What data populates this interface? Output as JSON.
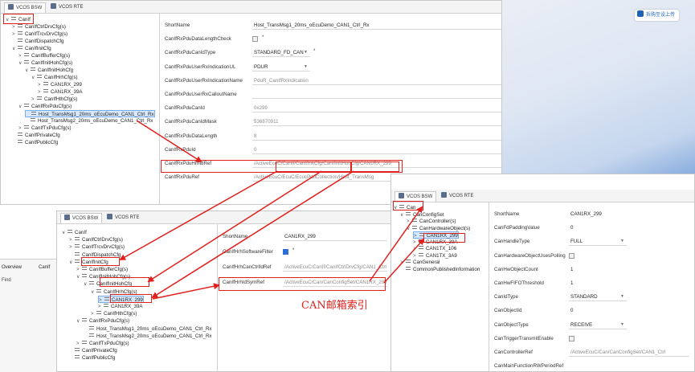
{
  "colors": {
    "annotation": "#e0201c",
    "selection": "#d6e8fb",
    "checkbox_on": "#2a6fd6",
    "desktop": "#1d63b8"
  },
  "ext_button": {
    "label": "拆购至设上传"
  },
  "panel1": {
    "tabs": [
      "VCOS BSW",
      "VCOS RTE"
    ],
    "tree": [
      {
        "label": "CanIf",
        "level": 0,
        "chev": "∨"
      },
      {
        "label": "CanIfCtrlDrvCfg(s)",
        "level": 1,
        "chev": ">"
      },
      {
        "label": "CanIfTrcvDrvCfg(s)",
        "level": 1,
        "chev": ">"
      },
      {
        "label": "CanIfDispatchCfg",
        "level": 1,
        "chev": ""
      },
      {
        "label": "CanIfInitCfg",
        "level": 1,
        "chev": "∨"
      },
      {
        "label": "CanIfBufferCfg(s)",
        "level": 2,
        "chev": ">"
      },
      {
        "label": "CanIfInitHohCfg(s)",
        "level": 2,
        "chev": "∨"
      },
      {
        "label": "CanIfInitHohCfg",
        "level": 3,
        "chev": "∨"
      },
      {
        "label": "CanIfHrhCfg(s)",
        "level": 4,
        "chev": "∨"
      },
      {
        "label": "CAN1RX_299",
        "level": 5,
        "chev": ">"
      },
      {
        "label": "CAN1RX_39A",
        "level": 5,
        "chev": ">"
      },
      {
        "label": "CanIfHthCfg(s)",
        "level": 4,
        "chev": ">"
      },
      {
        "label": "CanIfRxPduCfg(s)",
        "level": 2,
        "chev": "∨"
      },
      {
        "label": "Host_TransMsg1_20ms_oEcuDemo_CAN1_Ctrl_Rx",
        "level": 3,
        "chev": ""
      },
      {
        "label": "Host_TransMsg2_20ms_oEcuDemo_CAN1_Ctrl_Rx",
        "level": 3,
        "chev": ""
      },
      {
        "label": "CanIfTxPduCfg(s)",
        "level": 2,
        "chev": ">"
      },
      {
        "label": "CanIfPrivateCfg",
        "level": 1,
        "chev": ""
      },
      {
        "label": "CanIfPublicCfg",
        "level": 1,
        "chev": ""
      }
    ],
    "props": [
      {
        "label": "ShortName",
        "value": "Host_TransMsg1_20ms_oEcuDemo_CAN1_Ctrl_Rx",
        "style": "box"
      },
      {
        "label": "CanIfRxPduDataLengthCheck",
        "value": "",
        "style": "check",
        "star": "*"
      },
      {
        "label": "CanIfRxPduCanIdType",
        "value": "STANDARD_FD_CAN",
        "style": "drop",
        "star": "*"
      },
      {
        "label": "CanIfRxPduUserRxIndicationUL",
        "value": "PDUR",
        "style": "drop"
      },
      {
        "label": "CanIfRxPduUserRxIndicationName",
        "value": "PduR_CanIfRxIndication",
        "style": "grey"
      },
      {
        "label": "CanIfRxPduUserRxCalloutName",
        "value": "",
        "style": "grey"
      },
      {
        "label": "CanIfRxPduCanId",
        "value": "0x299",
        "style": "grey"
      },
      {
        "label": "CanIfRxPduCanIdMask",
        "value": "536870911",
        "style": "grey"
      },
      {
        "label": "CanIfRxPduDataLength",
        "value": "8",
        "style": "grey"
      },
      {
        "label": "CanIfRxPduId",
        "value": "0",
        "style": "grey"
      },
      {
        "label": "CanIfRxPduHrhIdRef",
        "value": "/ActiveEcuC/CanIf/CanIfInitCfg/CanIfInitHohCfg/CAN1RX_299",
        "style": "grey"
      },
      {
        "label": "CanIfRxPduRef",
        "value": "/ActiveEcuC/EcuC/EcucPduCollection/Host_TransMsg",
        "style": "grey"
      }
    ]
  },
  "panel2": {
    "tabs": [
      "VCOS BSW",
      "VCOS RTE"
    ],
    "tree": [
      {
        "label": "CanIf",
        "level": 0,
        "chev": "∨"
      },
      {
        "label": "CanIfCtrlDrvCfg(s)",
        "level": 1,
        "chev": ">"
      },
      {
        "label": "CanIfTrcvDrvCfg(s)",
        "level": 1,
        "chev": ">"
      },
      {
        "label": "CanIfDispatchCfg",
        "level": 1,
        "chev": ""
      },
      {
        "label": "CanIfInitCfg",
        "level": 1,
        "chev": "∨"
      },
      {
        "label": "CanIfBufferCfg(s)",
        "level": 2,
        "chev": ">"
      },
      {
        "label": "CanIfInitHohCfg(s)",
        "level": 2,
        "chev": "∨"
      },
      {
        "label": "CanIfInitHohCfg",
        "level": 3,
        "chev": "∨"
      },
      {
        "label": "CanIfHrhCfg(s)",
        "level": 4,
        "chev": "∨"
      },
      {
        "label": "CAN1RX_299",
        "level": 5,
        "chev": ">"
      },
      {
        "label": "CAN1RX_39A",
        "level": 5,
        "chev": ">"
      },
      {
        "label": "CanIfHthCfg(s)",
        "level": 4,
        "chev": ">"
      },
      {
        "label": "CanIfRxPduCfg(s)",
        "level": 2,
        "chev": "∨"
      },
      {
        "label": "Host_TransMsg1_20ms_oEcuDemo_CAN1_Ctrl_Rx",
        "level": 3,
        "chev": ""
      },
      {
        "label": "Host_TransMsg2_20ms_oEcuDemo_CAN1_Ctrl_Rx",
        "level": 3,
        "chev": ""
      },
      {
        "label": "CanIfTxPduCfg(s)",
        "level": 2,
        "chev": ">"
      },
      {
        "label": "CanIfPrivateCfg",
        "level": 1,
        "chev": ""
      },
      {
        "label": "CanIfPublicCfg",
        "level": 1,
        "chev": ""
      }
    ],
    "props": [
      {
        "label": "ShortName",
        "value": "CAN1RX_299",
        "style": "box"
      },
      {
        "label": "CanIfHrhSoftwareFilter",
        "value": "",
        "style": "checkon",
        "star": "*"
      },
      {
        "label": "CanIfHrhCanCtrlIdRef",
        "value": "/ActiveEcuC/CanIf/CanIfCtrlDrvCfg/CAN1_Ctrl",
        "style": "grey"
      },
      {
        "label": "CanIfHrhIdSymRef",
        "value": "/ActiveEcuC/Can/CanConfigSet/CAN1RX_299",
        "style": "grey"
      }
    ]
  },
  "panel3": {
    "tabs": [
      "VCOS BSW",
      "VCOS RTE"
    ],
    "tree": [
      {
        "label": "Can",
        "level": 0,
        "chev": "∨"
      },
      {
        "label": "CanConfigSet",
        "level": 1,
        "chev": "∨"
      },
      {
        "label": "CanController(s)",
        "level": 2,
        "chev": ">"
      },
      {
        "label": "CanHardwareObject(s)",
        "level": 2,
        "chev": "∨"
      },
      {
        "label": "CAN1RX_299",
        "level": 3,
        "chev": ">"
      },
      {
        "label": "CAN1RX_39A",
        "level": 3,
        "chev": ">"
      },
      {
        "label": "CAN1TX_106",
        "level": 3,
        "chev": ">"
      },
      {
        "label": "CAN1TX_3A9",
        "level": 3,
        "chev": ">"
      },
      {
        "label": "CanGeneral",
        "level": 1,
        "chev": ">"
      },
      {
        "label": "CommonPublishedInformation",
        "level": 1,
        "chev": ""
      }
    ],
    "props": [
      {
        "label": "ShortName",
        "value": "CAN1RX_299",
        "style": "plain"
      },
      {
        "label": "CanFdPaddingValue",
        "value": "0",
        "style": "plain"
      },
      {
        "label": "CanHandleType",
        "value": "FULL",
        "style": "drop"
      },
      {
        "label": "CanHardwareObjectUsesPolling",
        "value": "",
        "style": "check"
      },
      {
        "label": "CanHwObjectCount",
        "value": "1",
        "style": "plain"
      },
      {
        "label": "CanHwFIFOThreshold",
        "value": "1",
        "style": "plain"
      },
      {
        "label": "CanIdType",
        "value": "STANDARD",
        "style": "drop"
      },
      {
        "label": "CanObjectId",
        "value": "0",
        "style": "plain"
      },
      {
        "label": "CanObjectType",
        "value": "RECEIVE",
        "style": "drop"
      },
      {
        "label": "CanTriggerTransmitEnable",
        "value": "",
        "style": "check"
      },
      {
        "label": "CanControllerRef",
        "value": "/ActiveEcuC/Can/CanConfigSet/CAN1_Ctrl",
        "style": "grey"
      },
      {
        "label": "CanMainFunctionRWPeriodRef",
        "value": "",
        "style": "plain"
      }
    ]
  },
  "background": {
    "overview_tab": "Overview",
    "canif_tab": "CanIf",
    "find_label": "Find"
  },
  "annotation_caption": "CAN邮箱索引"
}
